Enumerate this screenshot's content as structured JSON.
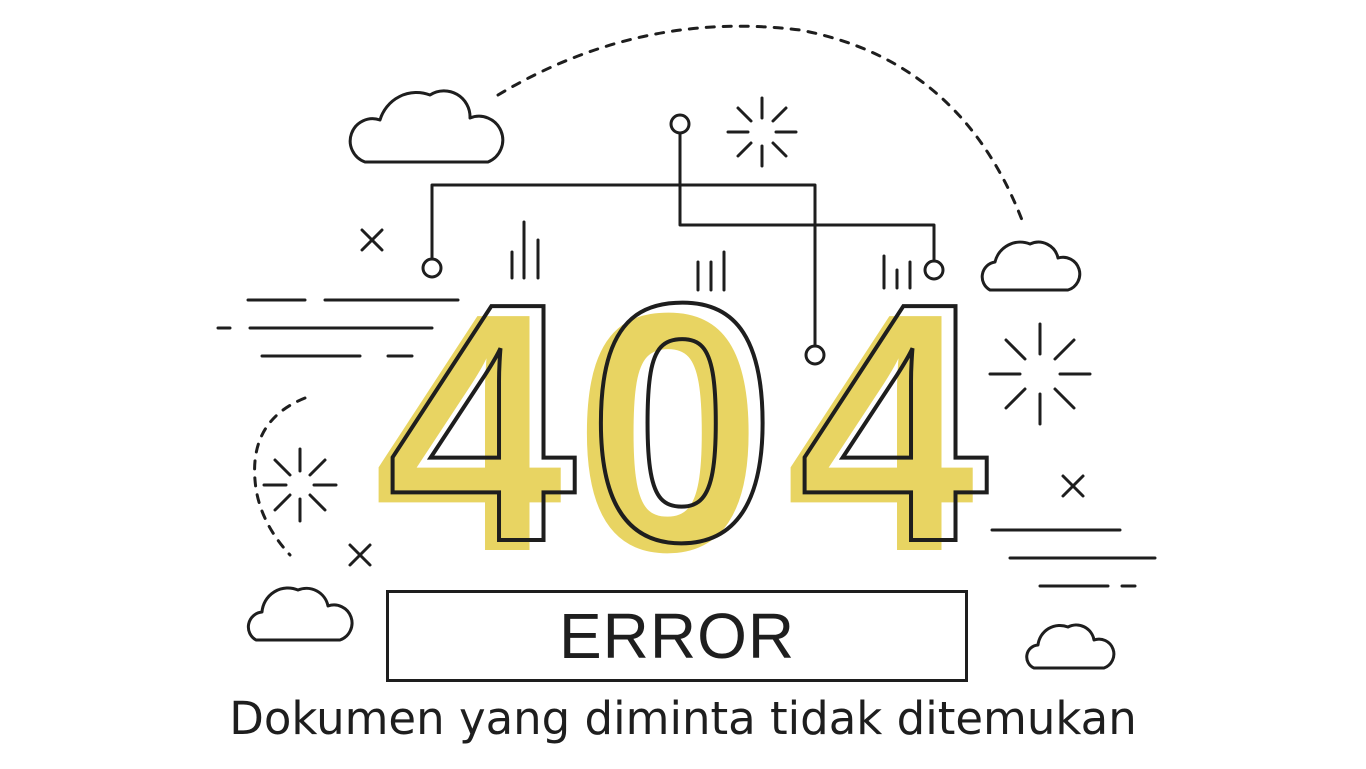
{
  "error_code": {
    "digits": [
      "4",
      "0",
      "4"
    ]
  },
  "error_label": "ERROR",
  "message": "Dokumen yang diminta tidak ditemukan",
  "colors": {
    "accent": "#e8d462",
    "stroke": "#1e1e1e",
    "background": "#ffffff"
  },
  "decorations": [
    "cloud-icon",
    "sparkle-icon",
    "cross-icon",
    "circuit-lines",
    "speed-lines",
    "dashed-arc"
  ]
}
